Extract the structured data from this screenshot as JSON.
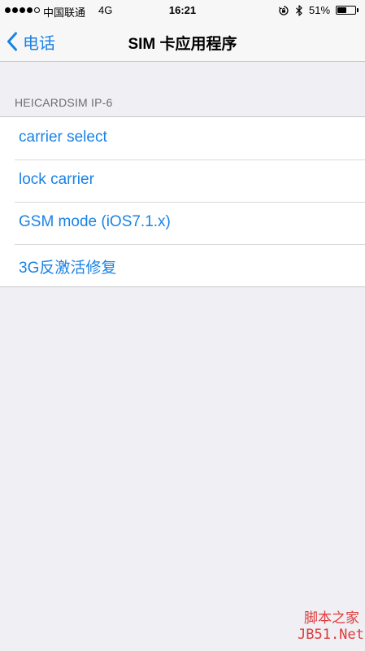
{
  "status_bar": {
    "signal_icon": "signal-strength-4-of-5",
    "carrier": "中国联通",
    "network": "4G",
    "time": "16:21",
    "orientation_lock_icon": "orientation-lock-icon",
    "bluetooth_icon": "bluetooth-icon",
    "battery_percent": "51%",
    "battery_level": 0.51
  },
  "nav_bar": {
    "back_label": "电话",
    "title": "SIM 卡应用程序"
  },
  "section": {
    "header": "HEICARDSIM IP-6",
    "items": [
      {
        "label": "carrier select"
      },
      {
        "label": "lock carrier"
      },
      {
        "label": "GSM mode (iOS7.1.x)"
      },
      {
        "label": "3G反激活修复"
      }
    ]
  },
  "watermark": {
    "line1": "脚本之家",
    "line2": "JB51.Net"
  },
  "colors": {
    "accent": "#1a82e6",
    "background": "#efeff4",
    "bar_background": "#f7f7f7",
    "section_header": "#6d6d72",
    "watermark": "#e03a3a"
  }
}
